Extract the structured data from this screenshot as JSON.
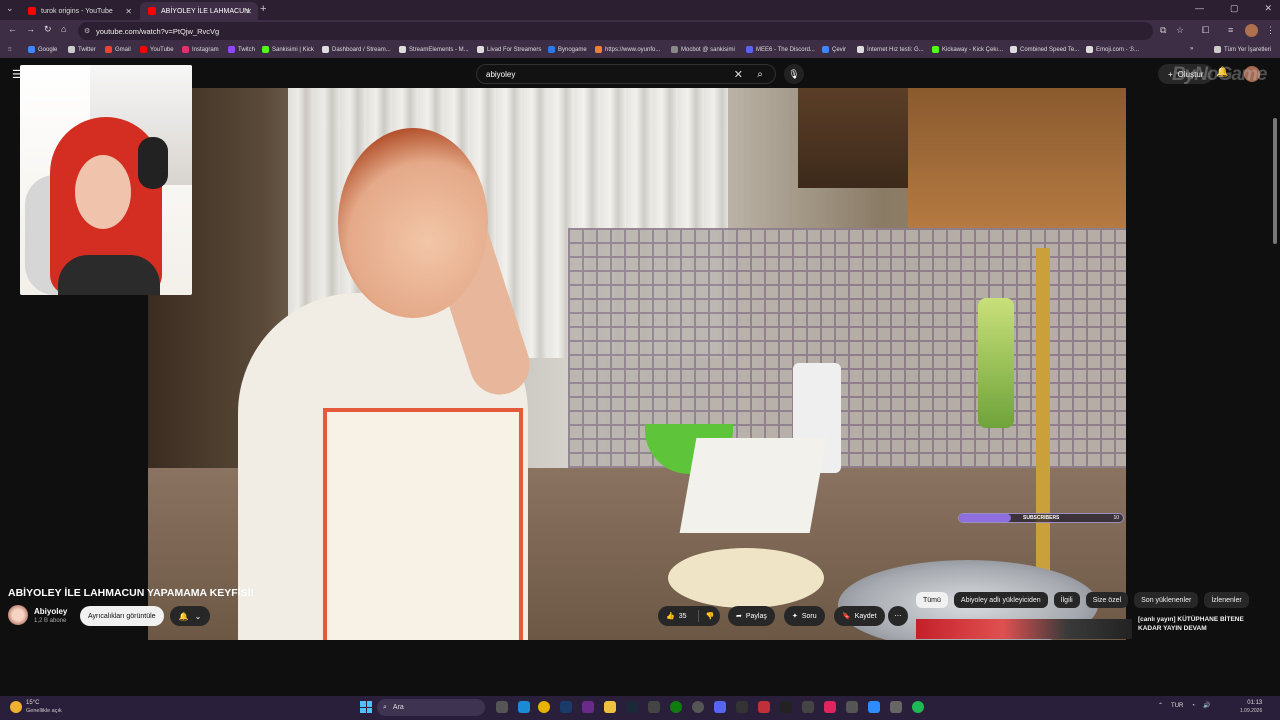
{
  "browser": {
    "tabs": [
      {
        "title": "turok origins - YouTube"
      },
      {
        "title": "ABİYOLEY İLE LAHMACUN"
      }
    ],
    "url": "youtube.com/watch?v=PtQjw_RvcVg",
    "bookmarks": [
      {
        "label": "Google",
        "color": "#4285f4"
      },
      {
        "label": "Twitter",
        "color": "#cccccc"
      },
      {
        "label": "Gmail",
        "color": "#ea4335"
      },
      {
        "label": "YouTube",
        "color": "#ff0000"
      },
      {
        "label": "Instagram",
        "color": "#e1306c"
      },
      {
        "label": "Twitch",
        "color": "#9146ff"
      },
      {
        "label": "Sankisimi | Kick",
        "color": "#53fc18"
      },
      {
        "label": "Dashboard / Stream...",
        "color": "#dddddd"
      },
      {
        "label": "StreamElements - M...",
        "color": "#dddddd"
      },
      {
        "label": "Livad For Streamers",
        "color": "#dddddd"
      },
      {
        "label": "Bynogame",
        "color": "#2a7ae2"
      },
      {
        "label": "https://www.oyunfo...",
        "color": "#f08030"
      },
      {
        "label": "Mocbot @ sankisimi",
        "color": "#888888"
      },
      {
        "label": "MEE6 - The Discord...",
        "color": "#5865f2"
      },
      {
        "label": "Çevir",
        "color": "#4285f4"
      },
      {
        "label": "İnternet Hız testi: G...",
        "color": "#dddddd"
      },
      {
        "label": "Kickaway - Kick Çekı...",
        "color": "#53fc18"
      },
      {
        "label": "Combined Speed Te...",
        "color": "#dddddd"
      },
      {
        "label": "Emoji.com - ℬ...",
        "color": "#dddddd"
      }
    ],
    "all_bookmarks": "Tüm Yer İşaretleri"
  },
  "youtube": {
    "search_query": "abiyoley",
    "create_label": "Oluştur",
    "watermark": "ByNoGame",
    "subs_goal": {
      "label": "SUBSCRIBERS",
      "count": "10",
      "progress": 0.32
    },
    "video": {
      "title": "ABİYOLEY İLE LAHMACUN YAPAMAMA KEYFİSİ!",
      "channel": "Abiyoley",
      "subscribers": "1,2 B abone",
      "join_label": "Ayrıcalıkları görüntüle",
      "likes": "35",
      "share_label": "Paylaş",
      "ask_label": "Soru",
      "save_label": "Kaydet"
    },
    "chips": [
      {
        "label": "Tümü",
        "selected": true
      },
      {
        "label": "Abiyoley adlı yükleyiciden",
        "selected": false
      },
      {
        "label": "İlgili",
        "selected": false
      },
      {
        "label": "Size özel",
        "selected": false
      },
      {
        "label": "Son yüklenenler",
        "selected": false
      },
      {
        "label": "İzlenenler",
        "selected": false
      }
    ],
    "recommendation": {
      "title": "[canlı yayın] KÜTÜPHANE BİTENE KADAR YAYIN DEVAM"
    }
  },
  "taskbar": {
    "weather_temp": "15°C",
    "weather_desc": "Genellikle açık",
    "search_placeholder": "Ara",
    "lang": "TUR",
    "time": "01:13",
    "date": "1.09.2026",
    "accent": "#4cc2ff"
  }
}
